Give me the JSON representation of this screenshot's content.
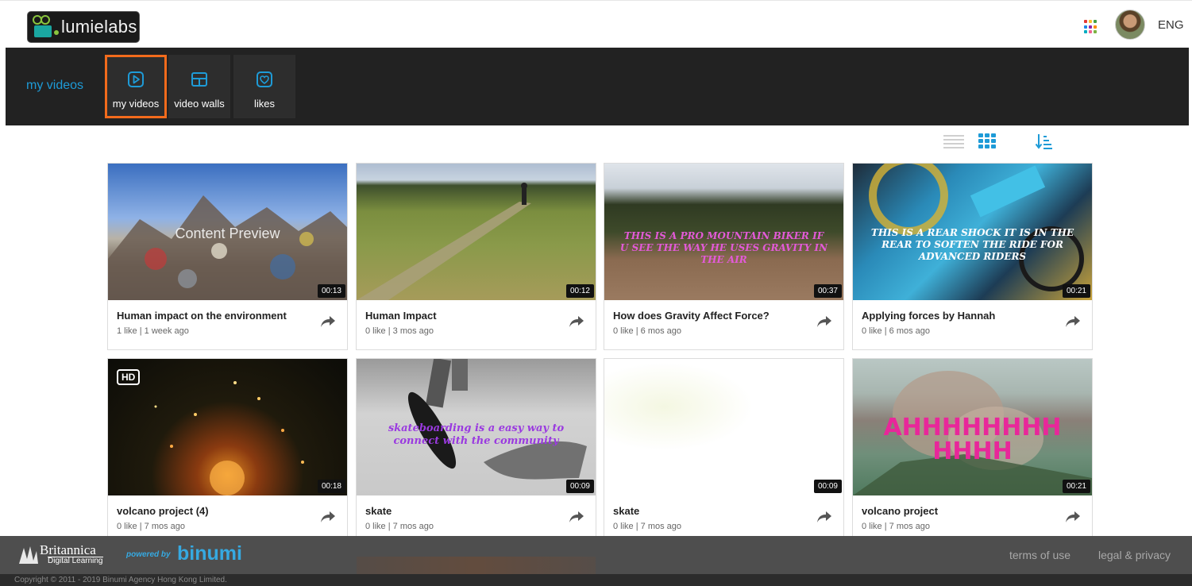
{
  "header": {
    "logo_text": "lumielabs",
    "apps_icon": "grid-apps-icon",
    "apps_colors": [
      "#e53935",
      "#fbc02d",
      "#43a047",
      "#1e88e5",
      "#8e24aa",
      "#fb8c00",
      "#00acc1",
      "#f06292",
      "#7cb342"
    ],
    "language": "ENG"
  },
  "nav": {
    "section_title": "my videos",
    "tabs": [
      {
        "label": "my videos",
        "icon": "play-square-icon",
        "active": true
      },
      {
        "label": "video walls",
        "icon": "wall-layout-icon",
        "active": false
      },
      {
        "label": "likes",
        "icon": "heart-square-icon",
        "active": false
      }
    ]
  },
  "colors": {
    "accent": "#1e9bd7",
    "active_outline": "#f36b1c",
    "nav_bg": "#222222"
  },
  "view_controls": {
    "active_view": "grid",
    "icons": [
      "list-view-icon",
      "grid-view-icon",
      "sort-icon"
    ]
  },
  "videos": [
    {
      "title": "Human impact on the environment",
      "meta": "1 like | 1 week ago",
      "duration": "00:13",
      "overlay": "Content Preview"
    },
    {
      "title": "Human Impact",
      "meta": "0 like | 3 mos ago",
      "duration": "00:12"
    },
    {
      "title": "How does Gravity Affect Force?",
      "meta": "0 like | 6 mos ago",
      "duration": "00:37",
      "caption": "THIS IS A PRO MOUNTAIN BIKER IF U SEE THE WAY HE USES GRAVITY IN THE AIR"
    },
    {
      "title": "Applying forces by Hannah",
      "meta": "0 like | 6 mos ago",
      "duration": "00:21",
      "caption": "THIS IS A REAR SHOCK IT IS IN THE REAR TO SOFTEN THE RIDE FOR ADVANCED RIDERS"
    },
    {
      "title": "volcano project (4)",
      "meta": "0 like | 7 mos ago",
      "duration": "00:18",
      "badge": "HD"
    },
    {
      "title": "skate",
      "meta": "0 like | 7 mos ago",
      "duration": "00:09",
      "caption": "skateboarding is a easy way to connect with the community"
    },
    {
      "title": "skate",
      "meta": "0 like | 7 mos ago",
      "duration": "00:09"
    },
    {
      "title": "volcano project",
      "meta": "0 like | 7 mos ago",
      "duration": "00:21",
      "caption": "AHHHHHHHH HHHH"
    }
  ],
  "footer": {
    "brand_name": "Britannica",
    "brand_sub": "Digital Learning",
    "powered_by": "powered by",
    "partner": "binumi",
    "links": [
      "terms of use",
      "legal & privacy"
    ],
    "copyright": "Copyright © 2011 - 2019 Binumi Agency Hong Kong Limited."
  }
}
